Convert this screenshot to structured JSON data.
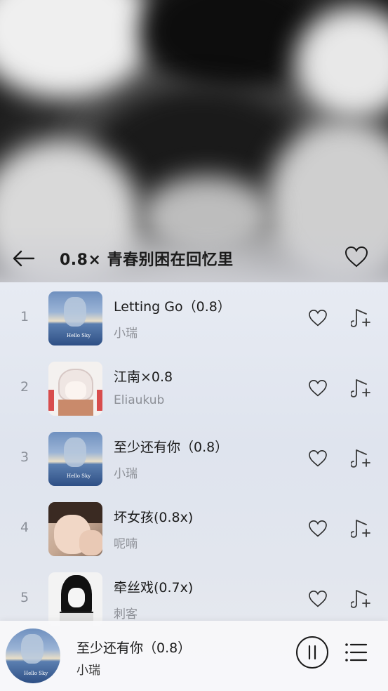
{
  "playlist": {
    "title": "0.8× 青春别困在回忆里"
  },
  "tracks": [
    {
      "index": "1",
      "title": "Letting Go（0.8）",
      "artist": "小瑞",
      "cover": "sky-cover"
    },
    {
      "index": "2",
      "title": "江南×0.8",
      "artist": "Eliaukub",
      "cover": "anime-girl-cover"
    },
    {
      "index": "3",
      "title": "至少还有你（0.8）",
      "artist": "小瑞",
      "cover": "sky-cover"
    },
    {
      "index": "4",
      "title": "坏女孩(0.8x)",
      "artist": "呢喃",
      "cover": "child-photo-cover"
    },
    {
      "index": "5",
      "title": "牵丝戏(0.7x)",
      "artist": "刺客",
      "cover": "manga-girl-cover"
    }
  ],
  "cover_caption": "Hello Sky",
  "now_playing": {
    "title": "至少还有你（0.8）",
    "artist": "小瑞",
    "state": "playing"
  },
  "icons": {
    "back": "back-arrow-icon",
    "favorite": "heart-icon",
    "add_to_playlist": "add-to-playlist-icon",
    "pause": "pause-icon",
    "queue": "playlist-queue-icon"
  },
  "colors": {
    "text_primary": "#1c1c1c",
    "text_secondary": "#8c8f96",
    "list_background": "#e4e8f0"
  }
}
